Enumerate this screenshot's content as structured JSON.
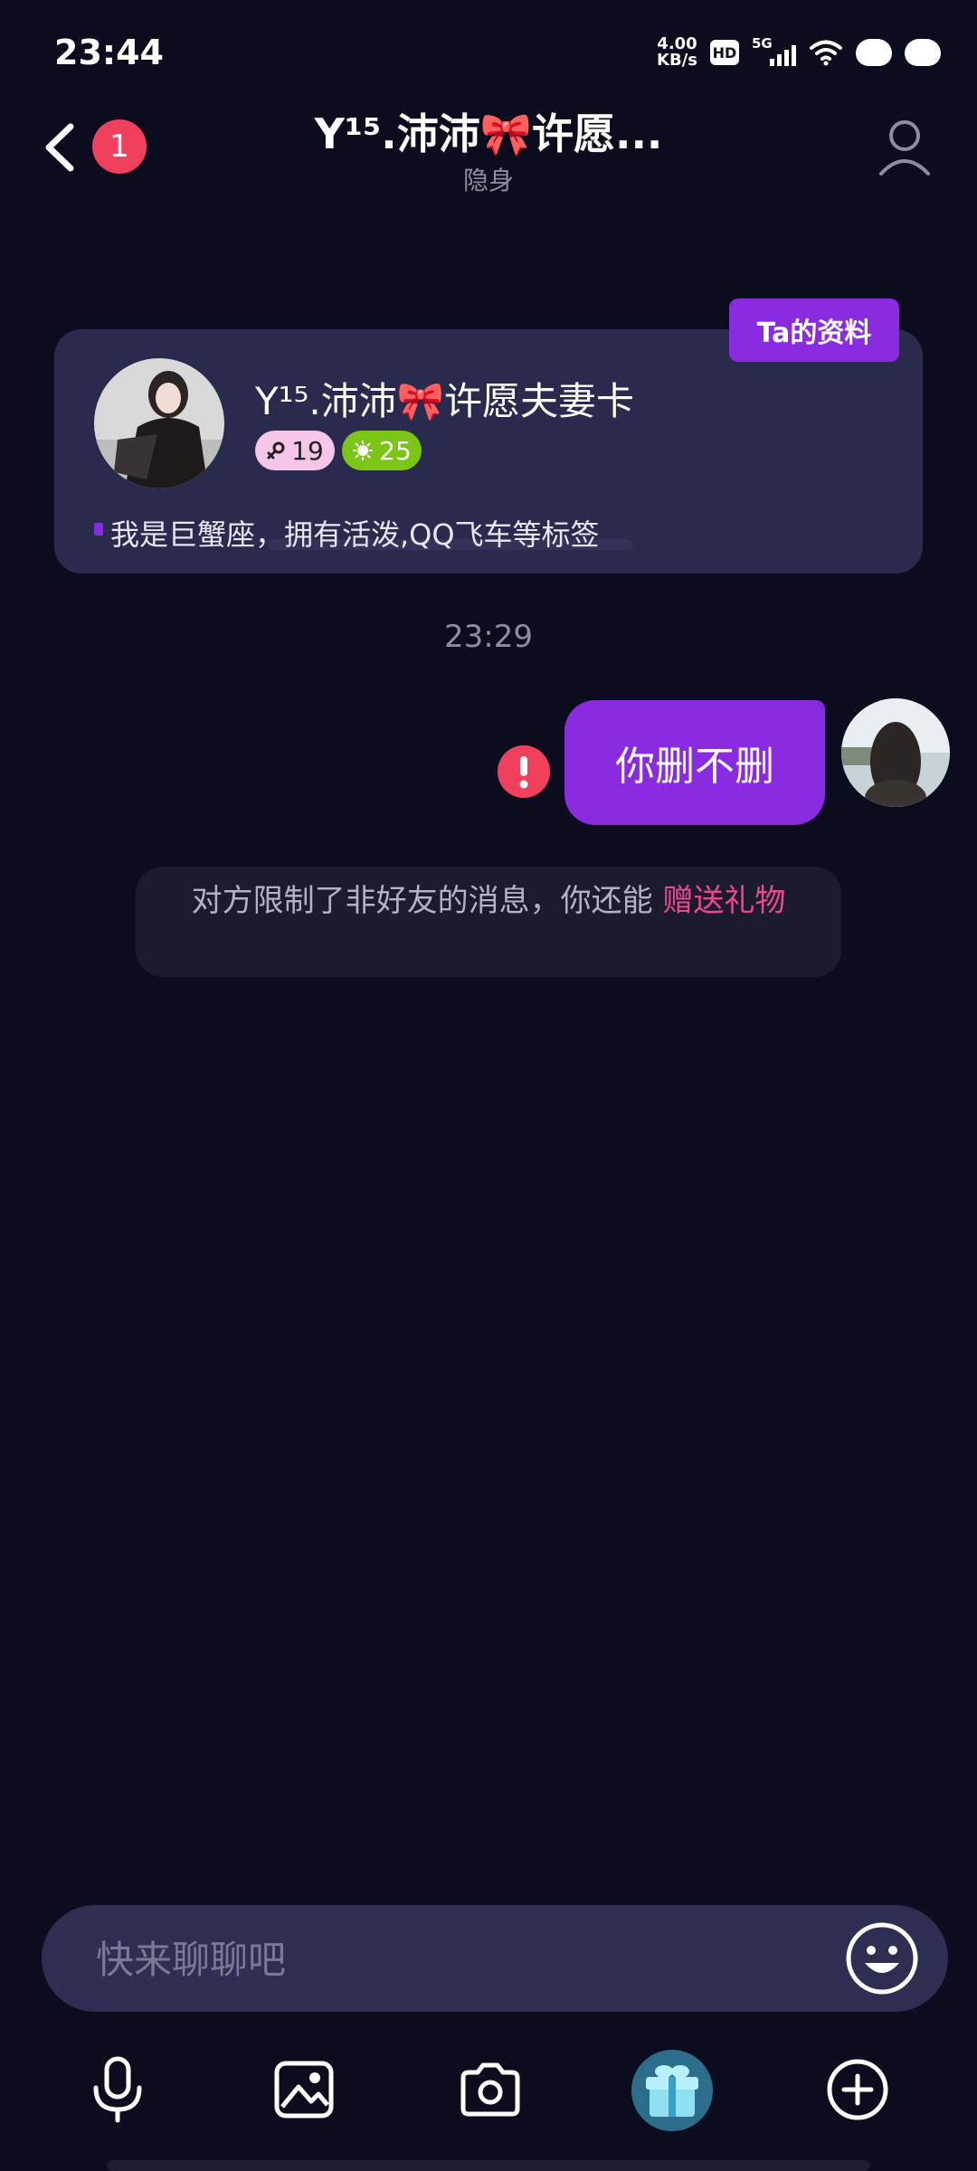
{
  "status_bar": {
    "time": "23:44",
    "net_speed_value": "4.00",
    "net_speed_unit": "KB/s",
    "hd_label": "HD",
    "network_label": "5G"
  },
  "header": {
    "unread_count": "1",
    "title": "Y¹⁵.沛沛🎀许愿...",
    "status": "隐身"
  },
  "profile_card": {
    "tag_label": "Ta的资料",
    "name": "Y¹⁵.沛沛🎀许愿夫妻卡",
    "age": "19",
    "level": "25",
    "bio": "我是巨蟹座，拥有活泼,QQ飞车等标签"
  },
  "messages": {
    "timestamp": "23:29",
    "sent_text": "你删不删",
    "notice_text": "对方限制了非好友的消息，你还能 ",
    "notice_link": "赠送礼物"
  },
  "composer": {
    "placeholder": "快来聊聊吧"
  },
  "toolbar": {
    "items": [
      "microphone-icon",
      "image-icon",
      "camera-icon",
      "gift-icon",
      "plus-icon"
    ]
  },
  "colors": {
    "background": "#0b0c1d",
    "accent": "#8a2be2",
    "badge": "#f0405e",
    "link": "#e94a8f",
    "card": "#2a2a4f"
  }
}
